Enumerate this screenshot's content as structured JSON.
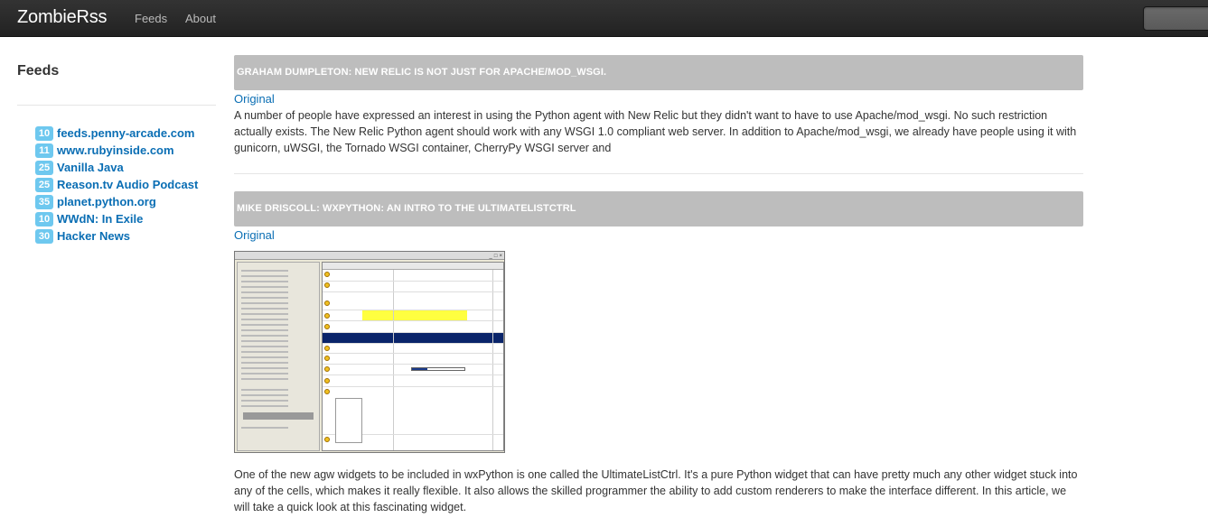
{
  "navbar": {
    "brand": "ZombieRss",
    "links": [
      "Feeds",
      "About"
    ]
  },
  "sidebar": {
    "title": "Feeds",
    "feeds": [
      {
        "count": "10",
        "name": "feeds.penny-arcade.com"
      },
      {
        "count": "11",
        "name": "www.rubyinside.com"
      },
      {
        "count": "25",
        "name": "Vanilla Java"
      },
      {
        "count": "25",
        "name": "Reason.tv Audio Podcast"
      },
      {
        "count": "35",
        "name": "planet.python.org"
      },
      {
        "count": "10",
        "name": "WWdN: In Exile"
      },
      {
        "count": "30",
        "name": "Hacker News"
      }
    ]
  },
  "posts": [
    {
      "title": "GRAHAM DUMPLETON: NEW RELIC IS NOT JUST FOR APACHE/MOD_WSGI.",
      "original_label": "Original",
      "body": "A number of people have expressed an interest in using the Python agent with New Relic but they didn't want to have to use Apache/mod_wsgi. No such restriction actually exists. The New Relic Python agent should work with any WSGI 1.0 compliant web server. In addition to Apache/mod_wsgi, we already have people using it with gunicorn, uWSGI, the Tornado WSGI container, CherryPy WSGI server and"
    },
    {
      "title": "MIKE DRISCOLL: WXPYTHON: AN INTRO TO THE ULTIMATELISTCTRL",
      "original_label": "Original",
      "body": "One of the new agw widgets to be included in wxPython is one called the UltimateListCtrl. It's a pure Python widget that can have pretty much any other widget stuck into any of the cells, which makes it really flexible. It also allows the skilled programmer the ability to add custom renderers to make the interface different. In this article, we will take a quick look at this fascinating widget."
    }
  ],
  "colors": {
    "navbar": "#222222",
    "badge": "#6ec8ef",
    "link": "#0a6eb4",
    "post_header": "#bdbdbd"
  }
}
